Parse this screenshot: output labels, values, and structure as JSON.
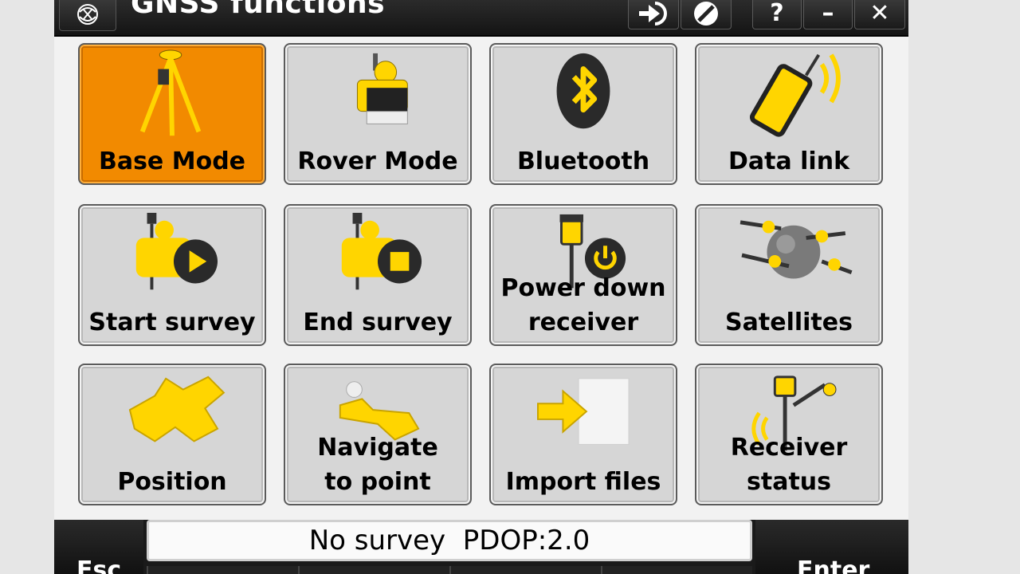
{
  "titlebar": {
    "title": "GNSS functions",
    "icons": [
      "trimble-logo-icon",
      "connect-icon",
      "no-entry-icon"
    ],
    "buttons": {
      "help": "?",
      "minimize": "–",
      "close": "✕"
    }
  },
  "tiles": [
    {
      "label": "Base Mode",
      "icon": "base-tripod-icon",
      "active": true
    },
    {
      "label": "Rover Mode",
      "icon": "rover-receiver-icon"
    },
    {
      "label": "Bluetooth",
      "icon": "bluetooth-icon"
    },
    {
      "label": "Data link",
      "icon": "radio-data-link-icon"
    },
    {
      "label": "Start survey",
      "icon": "start-survey-icon"
    },
    {
      "label": "End survey",
      "icon": "end-survey-icon"
    },
    {
      "label": "Power down\nreceiver",
      "icon": "power-down-icon"
    },
    {
      "label": "Satellites",
      "icon": "satellites-icon"
    },
    {
      "label": "Position",
      "icon": "position-icon"
    },
    {
      "label": "Navigate\nto point",
      "icon": "navigate-icon"
    },
    {
      "label": "Import files",
      "icon": "import-files-icon"
    },
    {
      "label": "Receiver\nstatus",
      "icon": "receiver-status-icon"
    }
  ],
  "status": {
    "text": "No survey  PDOP:2.0"
  },
  "softkeys": {
    "left": "Esc",
    "right": "Enter"
  },
  "colors": {
    "accent": "#f28a00",
    "tile": "#d6d6d6",
    "icon_yellow": "#ffd500"
  }
}
